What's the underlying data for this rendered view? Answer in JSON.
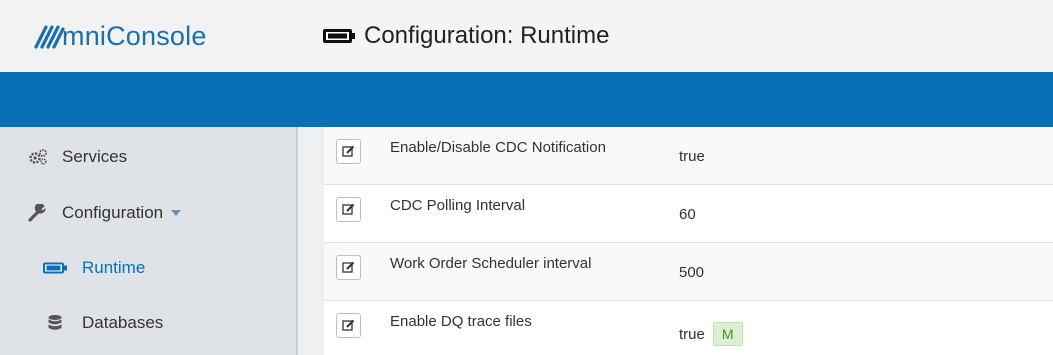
{
  "header": {
    "logo_text": "mniConsole",
    "page_title": "Configuration: Runtime"
  },
  "sidebar": {
    "items": [
      {
        "label": "Services",
        "icon": "gears-icon"
      },
      {
        "label": "Configuration",
        "icon": "wrench-icon",
        "expanded": true
      },
      {
        "label": "Runtime",
        "icon": "battery-icon",
        "active": true
      },
      {
        "label": "Databases",
        "icon": "database-icon"
      }
    ]
  },
  "settings": {
    "rows": [
      {
        "label": "Enable/Disable CDC Notification",
        "value": "true",
        "badge": ""
      },
      {
        "label": "CDC Polling Interval",
        "value": "60",
        "badge": ""
      },
      {
        "label": "Work Order Scheduler interval",
        "value": "500",
        "badge": ""
      },
      {
        "label": "Enable DQ trace files",
        "value": "true",
        "badge": "M"
      }
    ]
  },
  "colors": {
    "brand_blue": "#0770b6",
    "logo_blue": "#1a6fb0",
    "sidebar_bg": "#dfe3e8",
    "badge_green": "#dcefd2"
  }
}
